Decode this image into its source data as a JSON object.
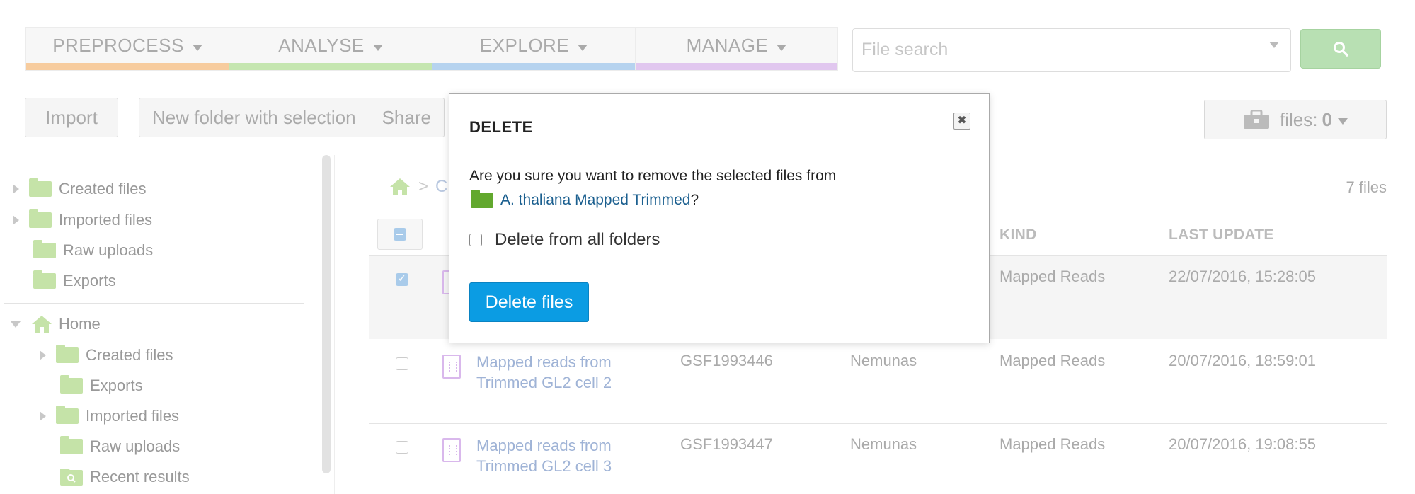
{
  "nav": {
    "items": [
      {
        "label": "PREPROCESS",
        "color": "#f7cc9e"
      },
      {
        "label": "ANALYSE",
        "color": "#c5e6b0"
      },
      {
        "label": "EXPLORE",
        "color": "#b6d3ef"
      },
      {
        "label": "MANAGE",
        "color": "#e1c7ef"
      }
    ]
  },
  "search": {
    "placeholder": "File search",
    "button_icon": "search-icon"
  },
  "toolbar": {
    "import_label": "Import",
    "new_folder_label": "New folder with selection",
    "share_label": "Share",
    "files_label": "files:",
    "files_count": "0"
  },
  "sidebar": {
    "items": [
      {
        "label": "Created files"
      },
      {
        "label": "Imported files"
      },
      {
        "label": "Raw uploads"
      },
      {
        "label": "Exports"
      },
      {
        "label": "Home"
      },
      {
        "label": "Created files"
      },
      {
        "label": "Exports"
      },
      {
        "label": "Imported files"
      },
      {
        "label": "Raw uploads"
      },
      {
        "label": "Recent results"
      }
    ]
  },
  "main": {
    "breadcrumb_sep": ">",
    "breadcrumb_partial": "C",
    "files_count": "7 files",
    "columns": {
      "kind": "KIND",
      "last_update": "LAST UPDATE"
    },
    "rows": [
      {
        "name": "",
        "id": "",
        "owner": "",
        "kind": "Mapped Reads",
        "updated": "22/07/2016, 15:28:05",
        "selected": true
      },
      {
        "name": "Mapped reads from Trimmed GL2 cell 2",
        "id": "GSF1993446",
        "owner": "Nemunas",
        "kind": "Mapped Reads",
        "updated": "20/07/2016, 18:59:01",
        "selected": false
      },
      {
        "name": "Mapped reads from Trimmed GL2 cell 3",
        "id": "GSF1993447",
        "owner": "Nemunas",
        "kind": "Mapped Reads",
        "updated": "20/07/2016, 19:08:55",
        "selected": false
      }
    ]
  },
  "modal": {
    "title": "DELETE",
    "close_symbol": "✖",
    "message": "Are you sure you want to remove the selected files from",
    "folder_name": "A. thaliana Mapped Trimmed",
    "suffix": "?",
    "checkbox_label": "Delete from all folders",
    "confirm_label": "Delete files"
  }
}
